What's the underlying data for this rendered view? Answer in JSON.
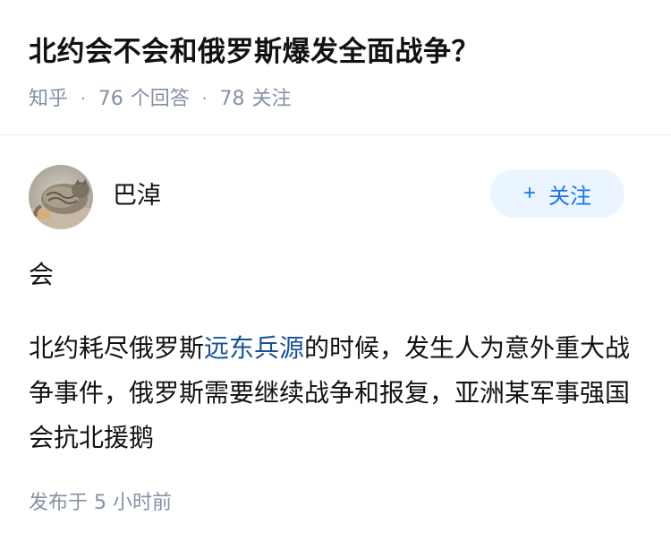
{
  "question": {
    "title": "北约会不会和俄罗斯爆发全面战争？",
    "source": "知乎",
    "answer_count": "76",
    "answer_label": "个回答",
    "follower_count": "78",
    "follower_label": "关注"
  },
  "author": {
    "name": "巴淖",
    "follow_label": "关注",
    "follow_icon": "plus-icon"
  },
  "answer": {
    "first_line": "会",
    "text_before_link": "北约耗尽俄罗斯",
    "link_text": "远东兵源",
    "text_after_link": "的时候，发生人为意外重大战争事件，俄罗斯需要继续战争和报复，亚洲某军事强国会抗北援鹅",
    "link_color": "#175199"
  },
  "footer": {
    "published_label": "发布于",
    "published_time": "5 小时前"
  },
  "colors": {
    "accent": "#1772f6",
    "follow_bg": "#ebf5ff",
    "meta": "#8590a6"
  }
}
